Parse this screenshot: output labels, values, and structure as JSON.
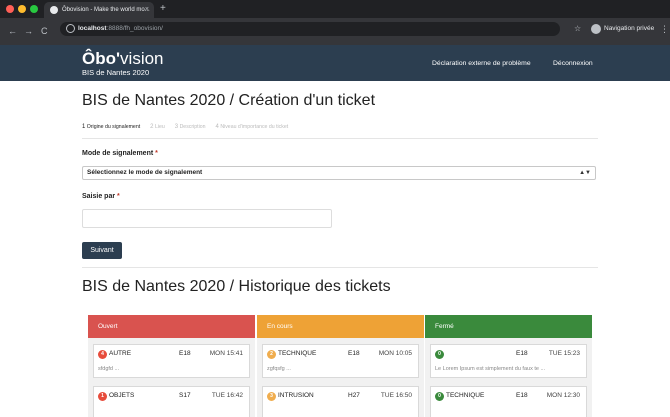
{
  "browser": {
    "tab_title": "Ôbovision - Make the world mo...",
    "tab_close": "×",
    "new_tab": "+",
    "url_host": "localhost",
    "url_rest": ":8888/fh_obovision/",
    "profile_label": "Navigation privée",
    "back": "←",
    "forward": "→",
    "reload": "C",
    "star": "☆",
    "menu": "⋮"
  },
  "navbar": {
    "brand_bold": "Ôbo'",
    "brand_light": "vision",
    "brand_sub": "BIS de Nantes 2020",
    "links": [
      "Déclaration externe de problème",
      "Déconnexion"
    ]
  },
  "form": {
    "title": "BIS de Nantes 2020 / Création d'un ticket",
    "steps": [
      {
        "num": "1",
        "label": "Origine du signalement"
      },
      {
        "num": "2",
        "label": "Lieu"
      },
      {
        "num": "3",
        "label": "Description"
      },
      {
        "num": "4",
        "label": "Niveau d'importance du ticket"
      }
    ],
    "mode_label": "Mode de signalement",
    "required_mark": "*",
    "mode_select_value": "Sélectionnez le mode de signalement",
    "select_arrow": "▲▼",
    "saisie_label": "Saisie par",
    "submit_label": "Suivant"
  },
  "history": {
    "title": "BIS de Nantes 2020 / Historique des tickets",
    "columns": [
      {
        "name": "Ouvert",
        "color": "#d9534f",
        "cards": [
          {
            "badge": "4",
            "badge_color": "#e74c3c",
            "category": "AUTRE",
            "room": "E18",
            "date": "MON 15:41",
            "desc": "sfdgfd ..."
          },
          {
            "badge": "1",
            "badge_color": "#e74c3c",
            "category": "OBJETS",
            "room": "S17",
            "date": "TUE 16:42",
            "desc": ""
          }
        ]
      },
      {
        "name": "En cours",
        "color": "#eea236",
        "cards": [
          {
            "badge": "2",
            "badge_color": "#f0ad4e",
            "category": "TECHNIQUE",
            "room": "E18",
            "date": "MON 10:05",
            "desc": "zgfqsfg ..."
          },
          {
            "badge": "3",
            "badge_color": "#f0ad4e",
            "category": "INTRUSION",
            "room": "H27",
            "date": "TUE 16:50",
            "desc": ""
          }
        ]
      },
      {
        "name": "Fermé",
        "color": "#3a8a3c",
        "cards": [
          {
            "badge": "0",
            "badge_color": "#3a8a3c",
            "category": "",
            "room": "E18",
            "date": "TUE 15:23",
            "desc": "Le Lorem Ipsum est simplement du faux te ..."
          },
          {
            "badge": "0",
            "badge_color": "#3a8a3c",
            "category": "TECHNIQUE",
            "room": "E18",
            "date": "MON 12:30",
            "desc": ""
          }
        ]
      }
    ]
  }
}
